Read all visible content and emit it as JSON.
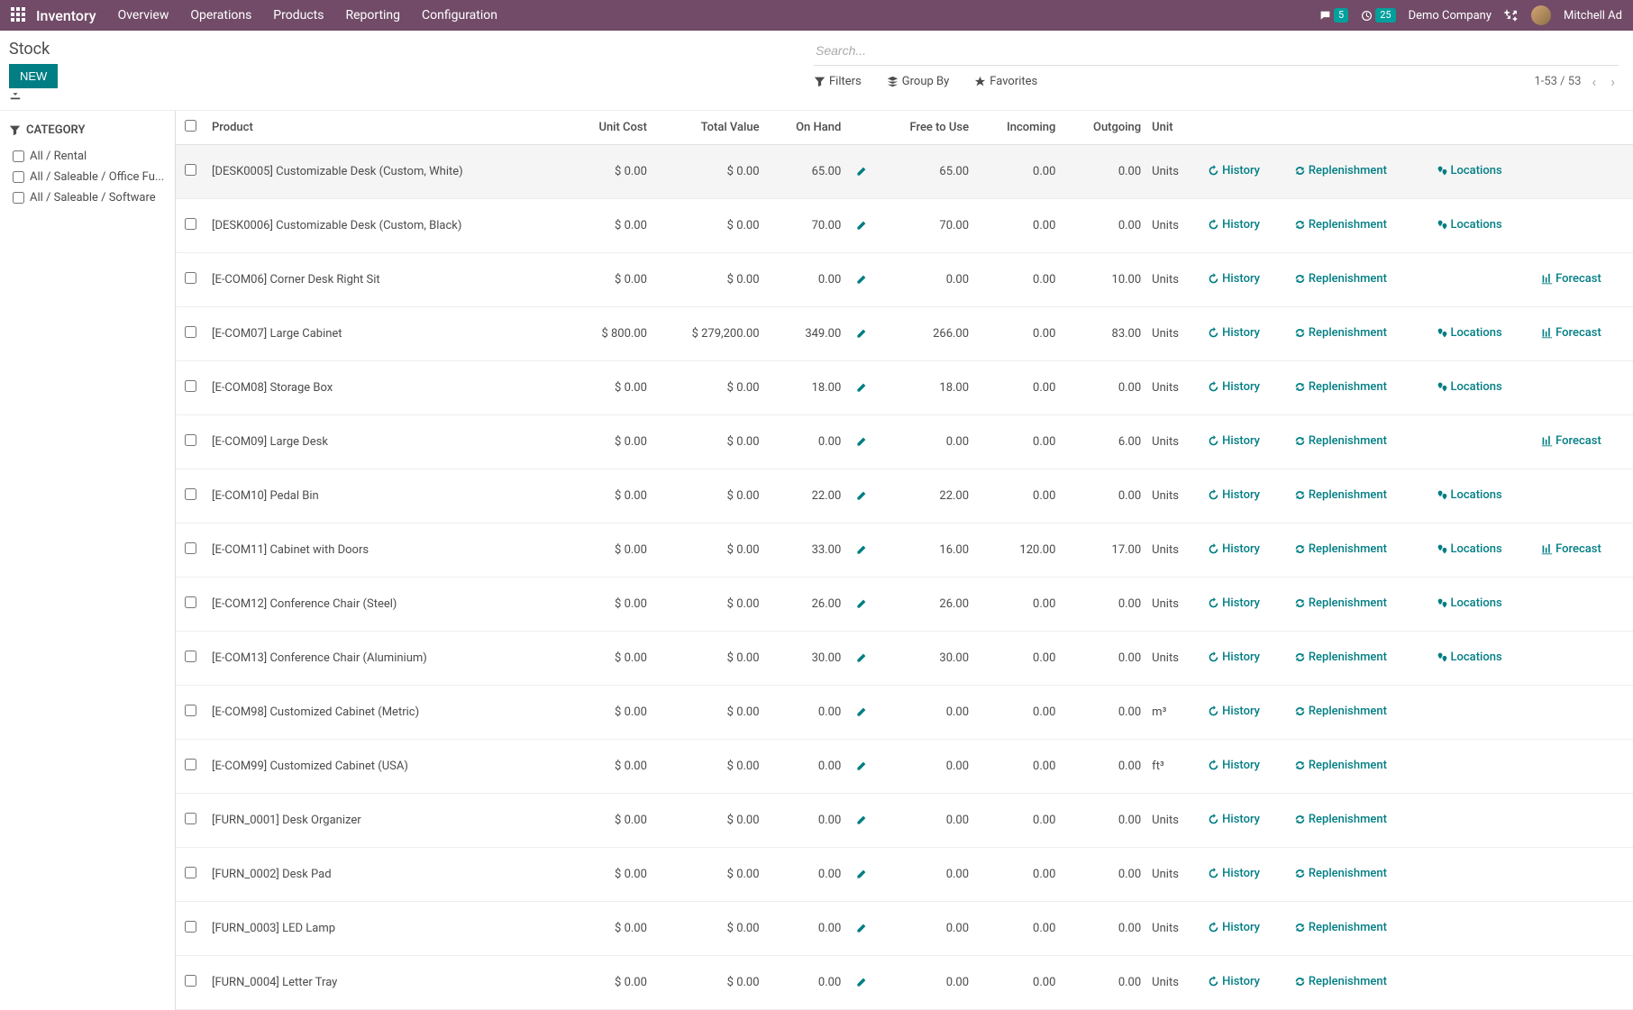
{
  "nav": {
    "brand": "Inventory",
    "items": [
      "Overview",
      "Operations",
      "Products",
      "Reporting",
      "Configuration"
    ],
    "chat_badge": "5",
    "clock_badge": "25",
    "company": "Demo Company",
    "user": "Mitchell Ad"
  },
  "page": {
    "title": "Stock",
    "new_btn": "NEW"
  },
  "search": {
    "placeholder": "Search...",
    "filters": "Filters",
    "groupby": "Group By",
    "favorites": "Favorites",
    "pager": "1-53 / 53"
  },
  "sidebar": {
    "title": "CATEGORY",
    "items": [
      {
        "label": "All / Rental"
      },
      {
        "label": "All / Saleable / Office Fu..."
      },
      {
        "label": "All / Saleable / Software"
      }
    ]
  },
  "columns": {
    "product": "Product",
    "unit_cost": "Unit Cost",
    "total_value": "Total Value",
    "on_hand": "On Hand",
    "free": "Free to Use",
    "incoming": "Incoming",
    "outgoing": "Outgoing",
    "unit": "Unit"
  },
  "actions": {
    "history": "History",
    "replenishment": "Replenishment",
    "locations": "Locations",
    "forecast": "Forecast"
  },
  "rows": [
    {
      "product": "[DESK0005] Customizable Desk (Custom, White)",
      "unit_cost": "$ 0.00",
      "total_value": "$ 0.00",
      "on_hand": "65.00",
      "free": "65.00",
      "incoming": "0.00",
      "outgoing": "0.00",
      "unit": "Units",
      "loc": true,
      "fc": false
    },
    {
      "product": "[DESK0006] Customizable Desk (Custom, Black)",
      "unit_cost": "$ 0.00",
      "total_value": "$ 0.00",
      "on_hand": "70.00",
      "free": "70.00",
      "incoming": "0.00",
      "outgoing": "0.00",
      "unit": "Units",
      "loc": true,
      "fc": false
    },
    {
      "product": "[E-COM06] Corner Desk Right Sit",
      "unit_cost": "$ 0.00",
      "total_value": "$ 0.00",
      "on_hand": "0.00",
      "free": "0.00",
      "incoming": "0.00",
      "outgoing": "10.00",
      "unit": "Units",
      "loc": false,
      "fc": true
    },
    {
      "product": "[E-COM07] Large Cabinet",
      "unit_cost": "$ 800.00",
      "total_value": "$ 279,200.00",
      "on_hand": "349.00",
      "free": "266.00",
      "incoming": "0.00",
      "outgoing": "83.00",
      "unit": "Units",
      "loc": true,
      "fc": true
    },
    {
      "product": "[E-COM08] Storage Box",
      "unit_cost": "$ 0.00",
      "total_value": "$ 0.00",
      "on_hand": "18.00",
      "free": "18.00",
      "incoming": "0.00",
      "outgoing": "0.00",
      "unit": "Units",
      "loc": true,
      "fc": false
    },
    {
      "product": "[E-COM09] Large Desk",
      "unit_cost": "$ 0.00",
      "total_value": "$ 0.00",
      "on_hand": "0.00",
      "free": "0.00",
      "incoming": "0.00",
      "outgoing": "6.00",
      "unit": "Units",
      "loc": false,
      "fc": true
    },
    {
      "product": "[E-COM10] Pedal Bin",
      "unit_cost": "$ 0.00",
      "total_value": "$ 0.00",
      "on_hand": "22.00",
      "free": "22.00",
      "incoming": "0.00",
      "outgoing": "0.00",
      "unit": "Units",
      "loc": true,
      "fc": false
    },
    {
      "product": "[E-COM11] Cabinet with Doors",
      "unit_cost": "$ 0.00",
      "total_value": "$ 0.00",
      "on_hand": "33.00",
      "free": "16.00",
      "incoming": "120.00",
      "outgoing": "17.00",
      "unit": "Units",
      "loc": true,
      "fc": true
    },
    {
      "product": "[E-COM12] Conference Chair (Steel)",
      "unit_cost": "$ 0.00",
      "total_value": "$ 0.00",
      "on_hand": "26.00",
      "free": "26.00",
      "incoming": "0.00",
      "outgoing": "0.00",
      "unit": "Units",
      "loc": true,
      "fc": false
    },
    {
      "product": "[E-COM13] Conference Chair (Aluminium)",
      "unit_cost": "$ 0.00",
      "total_value": "$ 0.00",
      "on_hand": "30.00",
      "free": "30.00",
      "incoming": "0.00",
      "outgoing": "0.00",
      "unit": "Units",
      "loc": true,
      "fc": false
    },
    {
      "product": "[E-COM98] Customized Cabinet (Metric)",
      "unit_cost": "$ 0.00",
      "total_value": "$ 0.00",
      "on_hand": "0.00",
      "free": "0.00",
      "incoming": "0.00",
      "outgoing": "0.00",
      "unit": "m³",
      "loc": false,
      "fc": false
    },
    {
      "product": "[E-COM99] Customized Cabinet (USA)",
      "unit_cost": "$ 0.00",
      "total_value": "$ 0.00",
      "on_hand": "0.00",
      "free": "0.00",
      "incoming": "0.00",
      "outgoing": "0.00",
      "unit": "ft³",
      "loc": false,
      "fc": false
    },
    {
      "product": "[FURN_0001] Desk Organizer",
      "unit_cost": "$ 0.00",
      "total_value": "$ 0.00",
      "on_hand": "0.00",
      "free": "0.00",
      "incoming": "0.00",
      "outgoing": "0.00",
      "unit": "Units",
      "loc": false,
      "fc": false
    },
    {
      "product": "[FURN_0002] Desk Pad",
      "unit_cost": "$ 0.00",
      "total_value": "$ 0.00",
      "on_hand": "0.00",
      "free": "0.00",
      "incoming": "0.00",
      "outgoing": "0.00",
      "unit": "Units",
      "loc": false,
      "fc": false
    },
    {
      "product": "[FURN_0003] LED Lamp",
      "unit_cost": "$ 0.00",
      "total_value": "$ 0.00",
      "on_hand": "0.00",
      "free": "0.00",
      "incoming": "0.00",
      "outgoing": "0.00",
      "unit": "Units",
      "loc": false,
      "fc": false
    },
    {
      "product": "[FURN_0004] Letter Tray",
      "unit_cost": "$ 0.00",
      "total_value": "$ 0.00",
      "on_hand": "0.00",
      "free": "0.00",
      "incoming": "0.00",
      "outgoing": "0.00",
      "unit": "Units",
      "loc": false,
      "fc": false
    }
  ]
}
